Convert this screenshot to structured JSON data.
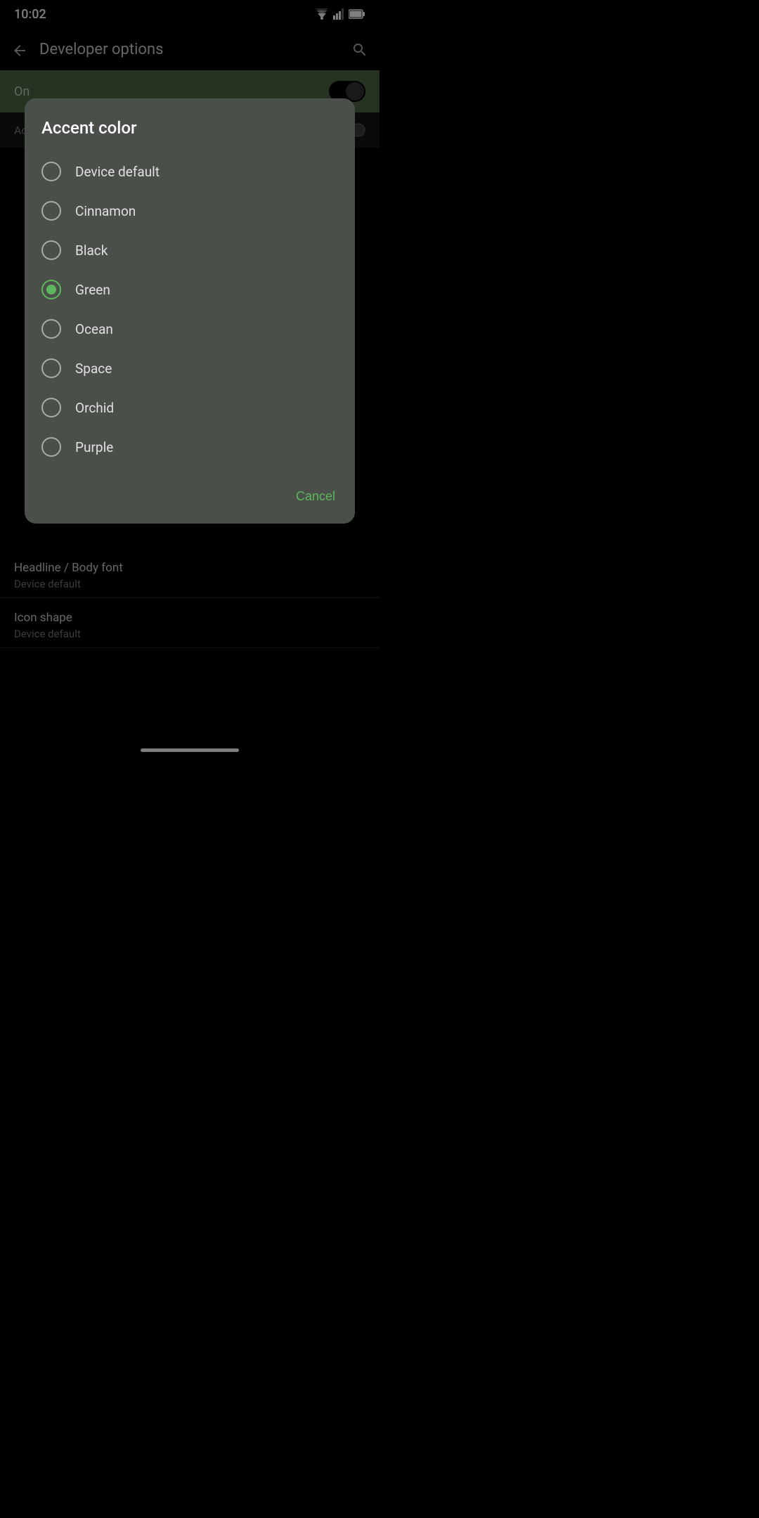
{
  "statusBar": {
    "time": "10:02"
  },
  "appBar": {
    "backLabel": "←",
    "title": "Developer options",
    "searchLabel": "🔍"
  },
  "greenBand": {
    "label": "On"
  },
  "dialog": {
    "title": "Accent color",
    "cancelLabel": "Cancel",
    "options": [
      {
        "id": "device-default",
        "label": "Device default",
        "selected": false
      },
      {
        "id": "cinnamon",
        "label": "Cinnamon",
        "selected": false
      },
      {
        "id": "black",
        "label": "Black",
        "selected": false
      },
      {
        "id": "green",
        "label": "Green",
        "selected": true
      },
      {
        "id": "ocean",
        "label": "Ocean",
        "selected": false
      },
      {
        "id": "space",
        "label": "Space",
        "selected": false
      },
      {
        "id": "orchid",
        "label": "Orchid",
        "selected": false
      },
      {
        "id": "purple",
        "label": "Purple",
        "selected": false
      }
    ]
  },
  "bgSettings": [
    {
      "title": "Headline / Body font",
      "subtitle": "Device default"
    },
    {
      "title": "Icon shape",
      "subtitle": "Device default"
    }
  ]
}
